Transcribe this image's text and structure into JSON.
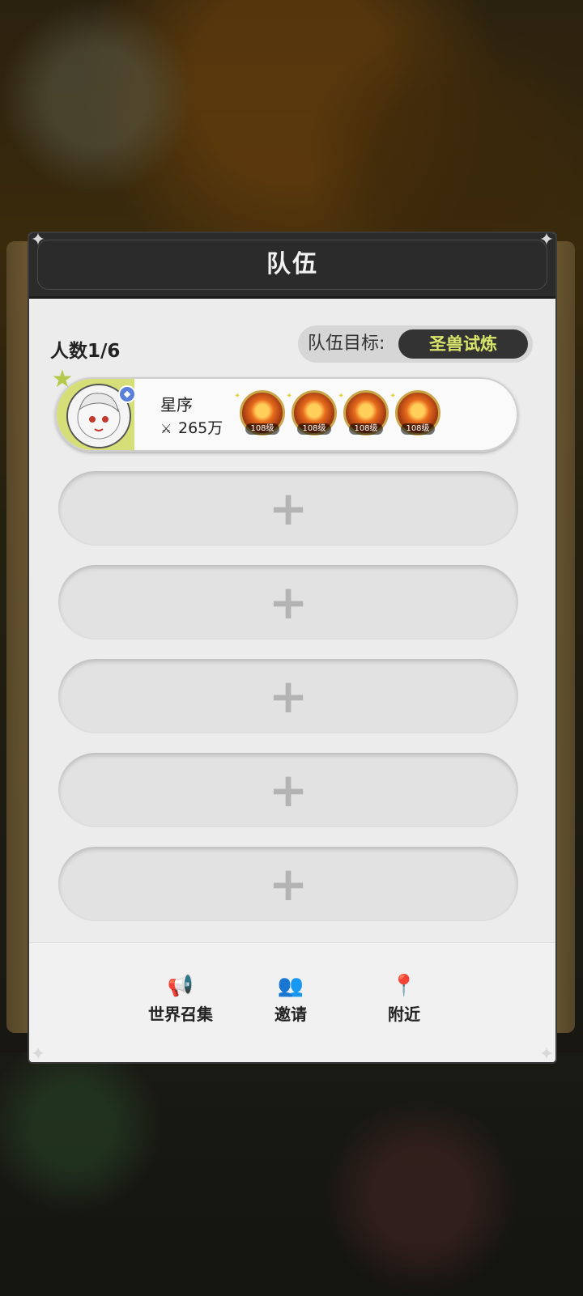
{
  "dialog": {
    "title": "队伍"
  },
  "team": {
    "count_label": "人数1/6",
    "goal_label": "队伍目标:",
    "goal_value": "圣兽试炼"
  },
  "member": {
    "name": "星序",
    "power": "265万",
    "skills": [
      {
        "level": "108级",
        "icon": "fire-orb-skill-icon"
      },
      {
        "level": "108级",
        "icon": "beast-roar-skill-icon"
      },
      {
        "level": "108级",
        "icon": "slash-skill-icon"
      },
      {
        "level": "108级",
        "icon": "flame-burst-skill-icon"
      }
    ]
  },
  "empty_slots": [
    {
      "symbol": "+"
    },
    {
      "symbol": "+"
    },
    {
      "symbol": "+"
    },
    {
      "symbol": "+"
    },
    {
      "symbol": "+"
    }
  ],
  "footer": {
    "world_recruit": "世界召集",
    "invite": "邀请",
    "nearby": "附近"
  }
}
